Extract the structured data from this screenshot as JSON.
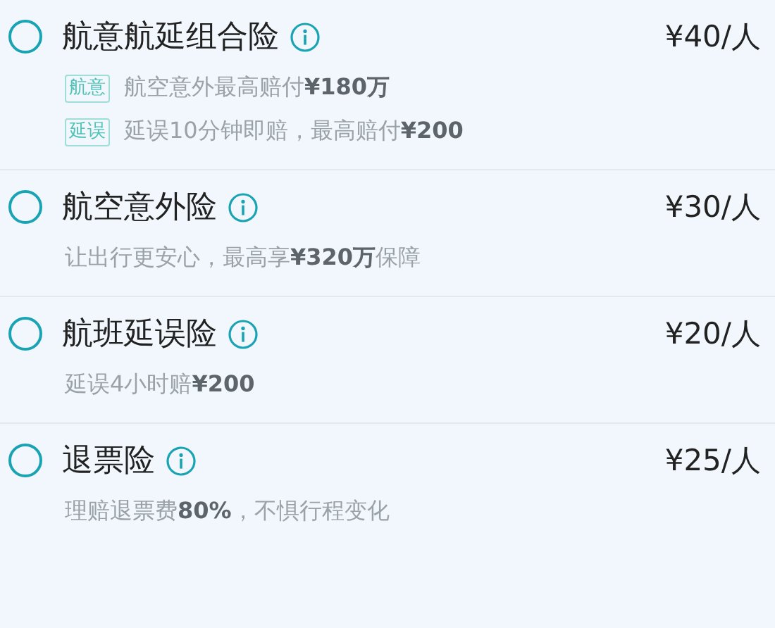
{
  "plans": [
    {
      "title": "航意航延组合险",
      "price": "¥40/人",
      "selected": false,
      "lines": [
        {
          "tag": "航意",
          "text": "航空意外最高赔付**¥180万**"
        },
        {
          "tag": "延误",
          "text": "延误10分钟即赔，最高赔付**¥200**"
        }
      ]
    },
    {
      "title": "航空意外险",
      "price": "¥30/人",
      "selected": false,
      "lines": [
        {
          "text": "让出行更安心，最高享**¥320万**保障"
        }
      ]
    },
    {
      "title": "航班延误险",
      "price": "¥20/人",
      "selected": false,
      "lines": [
        {
          "text": "延误4小时赔**¥200**"
        }
      ]
    },
    {
      "title": "退票险",
      "price": "¥25/人",
      "selected": false,
      "lines": [
        {
          "text": "理赔退票费**80%**，不惧行程变化"
        }
      ]
    }
  ]
}
